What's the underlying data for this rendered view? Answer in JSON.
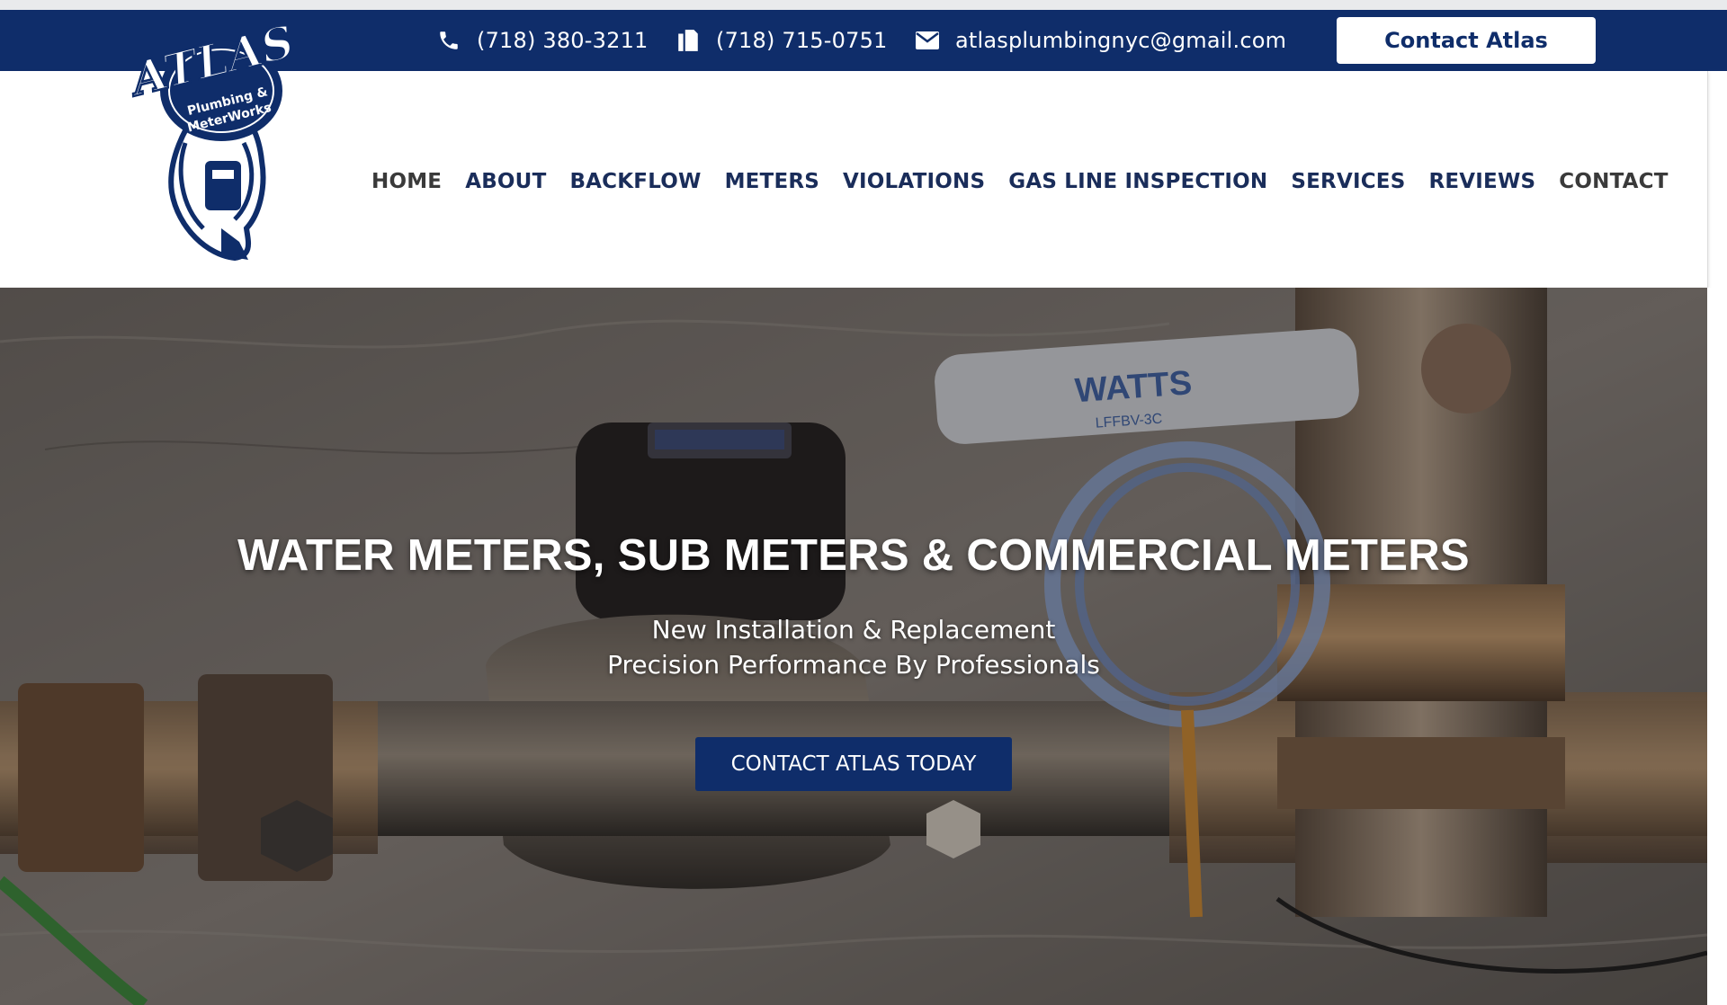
{
  "topbar": {
    "phone": "(718) 380-3211",
    "fax": "(718) 715-0751",
    "email": "atlasplumbingnyc@gmail.com",
    "contact_button": "Contact Atlas"
  },
  "logo": {
    "line1": "ATLAS",
    "line2": "Plumbing &",
    "line3": "MeterWorks"
  },
  "nav": [
    "HOME",
    "ABOUT",
    "BACKFLOW",
    "METERS",
    "VIOLATIONS",
    "GAS LINE INSPECTION",
    "SERVICES",
    "REVIEWS",
    "CONTACT"
  ],
  "hero": {
    "title": "WATER METERS, SUB METERS & COMMERCIAL METERS",
    "subtitle_line1": "New Installation & Replacement",
    "subtitle_line2": "Precision Performance By Professionals",
    "cta": "CONTACT ATLAS TODAY",
    "valve_brand": "WATTS",
    "valve_model": "LFFBV-3C"
  },
  "colors": {
    "brand_navy": "#0f2d6a",
    "nav_text": "#1a2d5a"
  }
}
